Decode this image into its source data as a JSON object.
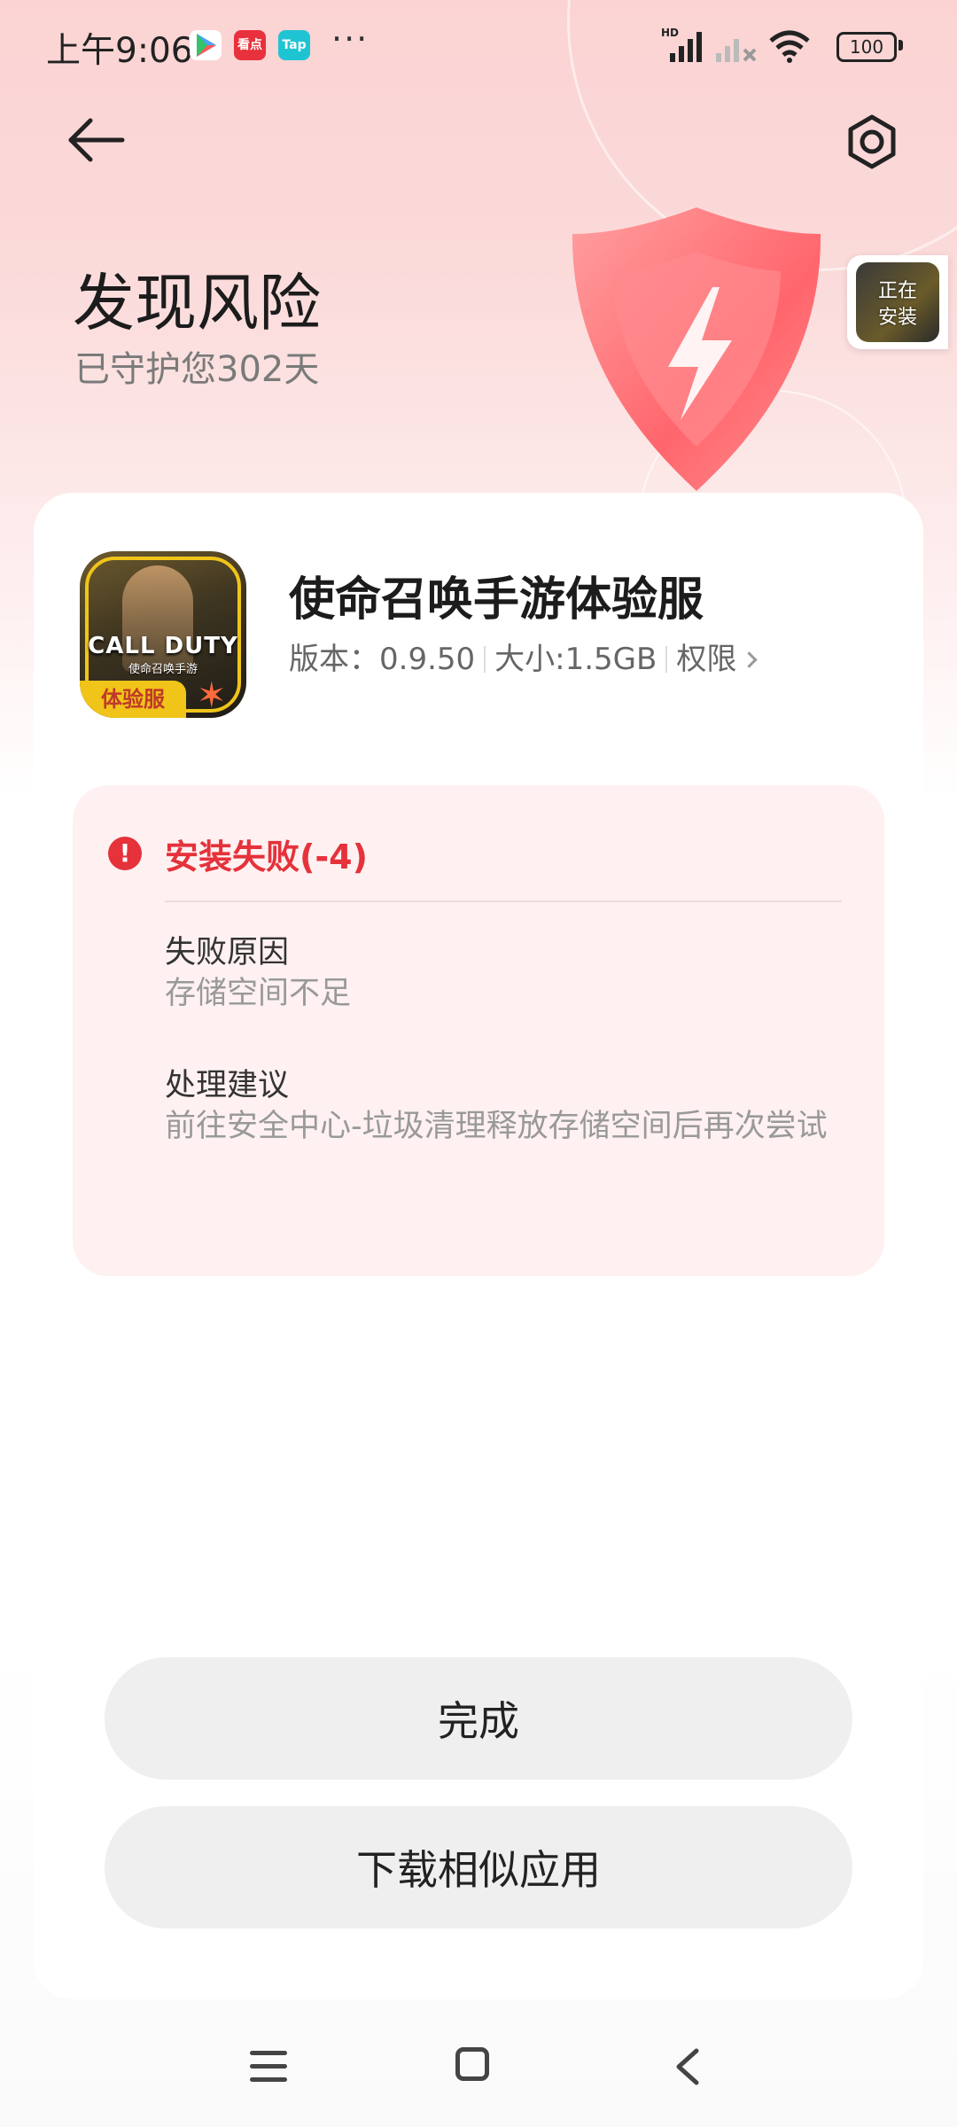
{
  "status_bar": {
    "time": "上午9:06",
    "notification_apps": [
      "play-store-icon",
      "kandian-icon",
      "tap-icon"
    ],
    "kandian_label": "看点",
    "tap_label": "Tap",
    "more": "···",
    "network_label": "HD",
    "battery": "100"
  },
  "header": {
    "title": "发现风险",
    "subtitle": "已守护您302天",
    "installing_badge": "正在\n安装"
  },
  "app": {
    "name": "使命召唤手游体验服",
    "version": "版本：0.9.50",
    "size": "大小:1.5GB",
    "permissions": "权限",
    "logo_title": "CALL DUTY",
    "logo_subtitle": "使命召唤手游",
    "logo_badge": "体验服"
  },
  "error": {
    "title": "安装失败(-4)",
    "reason_label": "失败原因",
    "reason_value": "存储空间不足",
    "suggestion_label": "处理建议",
    "suggestion_value": "前往安全中心-垃圾清理释放存储空间后再次尝试"
  },
  "buttons": {
    "done": "完成",
    "download_similar": "下载相似应用"
  },
  "colors": {
    "accent_red": "#e5323b",
    "button_bg": "#efefef",
    "error_panel_bg": "#fff1f1"
  }
}
